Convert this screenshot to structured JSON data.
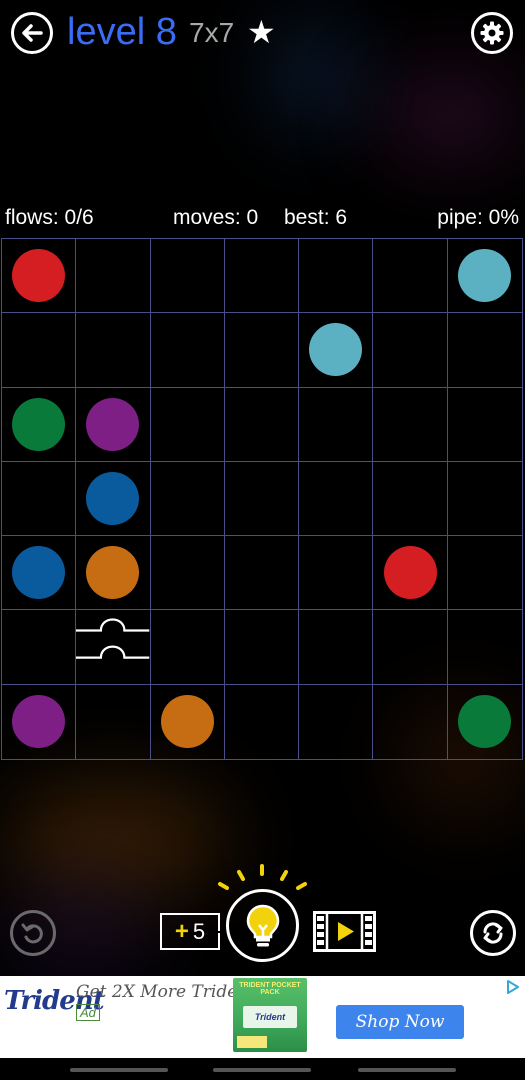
{
  "header": {
    "level_title": "level 8",
    "grid_size": "7x7",
    "star": "★"
  },
  "stats": {
    "flows": "flows: 0/6",
    "moves": "moves: 0",
    "best": "best: 6",
    "pipe": "pipe: 0%"
  },
  "colors": {
    "red": "#d41e22",
    "cyan": "#5bb1c1",
    "green": "#0a7a3a",
    "purple": "#7e1f86",
    "blue": "#0a5a9e",
    "orange": "#c66d14",
    "grid_line": "#4a4f8a",
    "title_blue": "#3a6cf4",
    "hint_yellow": "#f2d20c"
  },
  "board": {
    "size": 7,
    "dots": [
      {
        "row": 0,
        "col": 0,
        "color": "red"
      },
      {
        "row": 0,
        "col": 6,
        "color": "cyan"
      },
      {
        "row": 1,
        "col": 4,
        "color": "cyan"
      },
      {
        "row": 2,
        "col": 0,
        "color": "green"
      },
      {
        "row": 2,
        "col": 1,
        "color": "purple"
      },
      {
        "row": 3,
        "col": 1,
        "color": "blue"
      },
      {
        "row": 4,
        "col": 0,
        "color": "blue"
      },
      {
        "row": 4,
        "col": 1,
        "color": "orange"
      },
      {
        "row": 4,
        "col": 5,
        "color": "red"
      },
      {
        "row": 6,
        "col": 0,
        "color": "purple"
      },
      {
        "row": 6,
        "col": 2,
        "color": "orange"
      },
      {
        "row": 6,
        "col": 6,
        "color": "green"
      }
    ],
    "bridges": [
      {
        "row": 5,
        "col": 1
      }
    ]
  },
  "controls": {
    "hint_plus": "+",
    "hint_count": "5",
    "icons": {
      "back": "arrow-left-icon",
      "settings": "gear-icon",
      "undo": "undo-icon",
      "hint": "lightbulb-icon",
      "video": "video-play-icon",
      "refresh": "refresh-icon"
    }
  },
  "ad": {
    "logo": "Trident",
    "headline": "Get 2X More Trident",
    "badge": "Ad",
    "product_top": "TRIDENT POCKET PACK",
    "product_label": "Trident",
    "cta": "Shop Now"
  }
}
